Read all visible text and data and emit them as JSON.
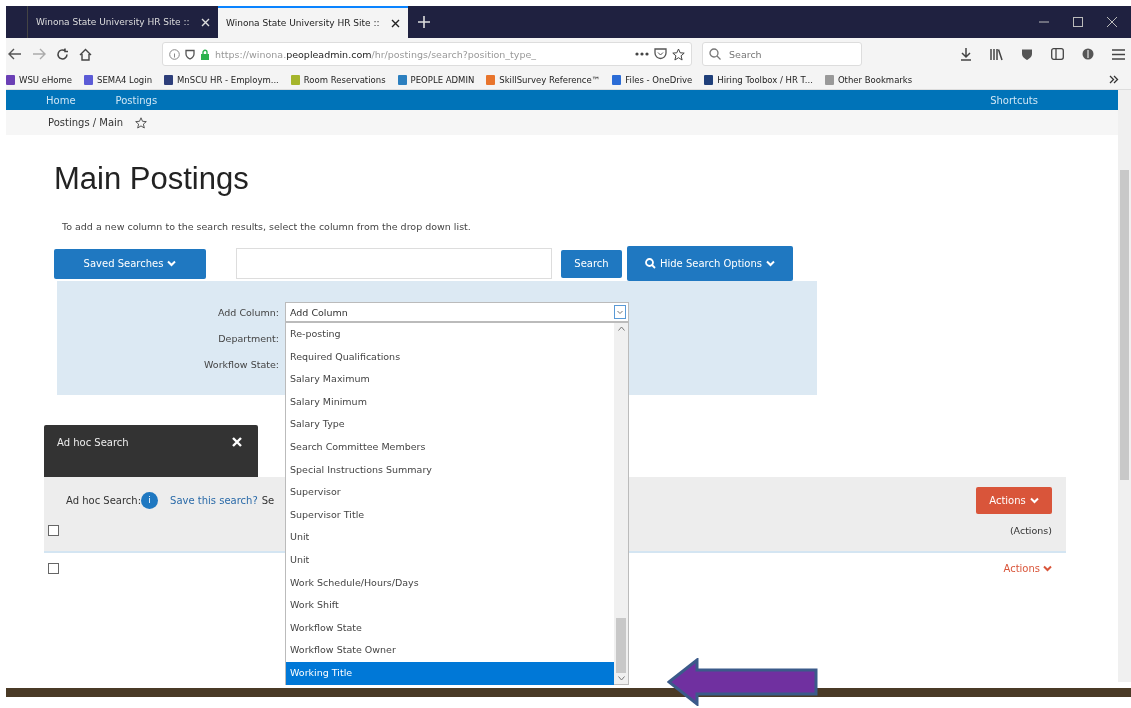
{
  "browser": {
    "tabs": [
      {
        "title": "Winona State University HR Site ::",
        "selected": false
      },
      {
        "title": "Winona State University HR Site ::",
        "selected": true
      }
    ],
    "url_pre": "https://winona.",
    "url_host": "peopleadmin.com",
    "url_post": "/hr/postings/search?position_type_",
    "search_placeholder": "Search",
    "bookmarks": [
      "WSU eHome",
      "SEMA4 Login",
      "MnSCU HR - Employm...",
      "Room Reservations",
      "PEOPLE ADMIN",
      "SkillSurvey Reference™",
      "Files - OneDrive",
      "Hiring Toolbox / HR T...",
      "Other Bookmarks"
    ]
  },
  "nav": {
    "items": [
      "Home",
      "Postings",
      "Shortcuts"
    ]
  },
  "breadcrumb": "Postings / Main",
  "heading": "Main Postings",
  "description": "To add a new column to the search results, select the column from the drop down list.",
  "search_bar": {
    "saved_searches": "Saved Searches",
    "search_button": "Search",
    "hide_options": "Hide Search Options"
  },
  "filters": {
    "labels": [
      "Add Column:",
      "Department:",
      "Workflow State:"
    ],
    "select_value": "Add Column",
    "options": [
      {
        "label": "Re-posting",
        "selected": false
      },
      {
        "label": "Required Qualifications",
        "selected": false
      },
      {
        "label": "Salary Maximum",
        "selected": false
      },
      {
        "label": "Salary Minimum",
        "selected": false
      },
      {
        "label": "Salary Type",
        "selected": false
      },
      {
        "label": "Search Committee Members",
        "selected": false
      },
      {
        "label": "Special Instructions Summary",
        "selected": false
      },
      {
        "label": "Supervisor",
        "selected": false
      },
      {
        "label": "Supervisor Title",
        "selected": false
      },
      {
        "label": "Unit",
        "selected": false
      },
      {
        "label": "Unit",
        "selected": false
      },
      {
        "label": "Work Schedule/Hours/Days",
        "selected": false
      },
      {
        "label": "Work Shift",
        "selected": false
      },
      {
        "label": "Workflow State",
        "selected": false
      },
      {
        "label": "Workflow State Owner",
        "selected": false
      },
      {
        "label": "Working Title",
        "selected": true
      }
    ]
  },
  "adhoc": {
    "title": "Ad hoc Search",
    "label": "Ad hoc Search:",
    "info": "i",
    "save_link": "Save this search?",
    "cut_text": "Se",
    "actions_button": "Actions",
    "actions_header": "(Actions)",
    "header_checked": false,
    "rows": [
      {
        "checked": false,
        "action": "Actions"
      }
    ]
  }
}
